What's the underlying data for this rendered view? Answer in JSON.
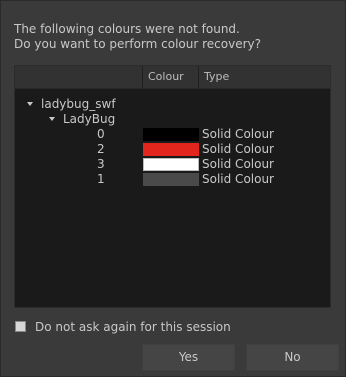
{
  "message": {
    "line1": "The following colours were not found.",
    "line2": "Do you want to perform colour recovery?"
  },
  "table": {
    "headers": {
      "name": "",
      "colour": "Colour",
      "type": "Type"
    },
    "tree": {
      "root": "ladybug_swf",
      "child": "LadyBug",
      "items": [
        {
          "id": "0",
          "colour": "#000000",
          "type": "Solid Colour"
        },
        {
          "id": "2",
          "colour": "#e3261d",
          "type": "Solid Colour"
        },
        {
          "id": "3",
          "colour": "#ffffff",
          "type": "Solid Colour"
        },
        {
          "id": "1",
          "colour": "#4a4a4a",
          "type": "Solid Colour"
        }
      ]
    }
  },
  "checkbox": {
    "label": "Do not ask again for this session",
    "checked": false
  },
  "buttons": {
    "yes": "Yes",
    "no": "No"
  }
}
